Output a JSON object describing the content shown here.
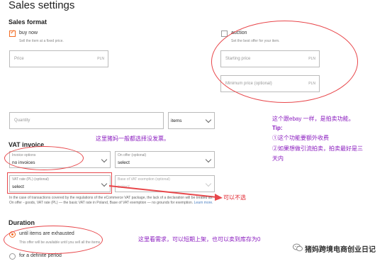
{
  "page": {
    "title": "Sales settings"
  },
  "sales_format": {
    "title": "Sales format",
    "buy_now": {
      "label": "buy now",
      "hint": "Sell the item at a fixed price.",
      "checked": true
    },
    "auction": {
      "label": "auction",
      "hint": "Set the best offer for your item.",
      "checked": false
    },
    "price": {
      "placeholder": "Price",
      "unit": "PLN"
    },
    "starting_price": {
      "placeholder": "Starting price",
      "unit": "PLN"
    },
    "minimum_price": {
      "placeholder": "Minimum price (optional)",
      "unit": "PLN"
    }
  },
  "quantity": {
    "placeholder": "Quantity",
    "unit_value": "items"
  },
  "vat_invoice": {
    "title": "VAT invoice",
    "invoice_options": {
      "label": "Invoice options",
      "value": "no invoices"
    },
    "on_offer": {
      "label": "On offer (optional)",
      "value": "select"
    },
    "vat_rate": {
      "label": "VAT rate (PL) (optional)",
      "value": "select"
    },
    "exemption": {
      "label": "Base of VAT exemption (optional)",
      "value": "select"
    },
    "note": "In the case of transactions covered by the regulations of the eCommerce VAT package, the lack of a declaration will be treated as: On offer - goods, VAT rate (PL) — the basic VAT rate in Poland, Base of VAT exemption — no grounds for exemption.",
    "learn_more": "Learn more."
  },
  "duration": {
    "title": "Duration",
    "until_exhausted": {
      "label": "until items are exhausted",
      "hint": "This offer will be available until you sell all the items.",
      "checked": true
    },
    "definite_period": {
      "label": "for a definite period",
      "checked": false
    }
  },
  "annotations": {
    "ebay_title": "这个跟ebay 一样，是拍卖功能。",
    "tip_label": "Tip:",
    "tip_1": "①这个功能要额外收费",
    "tip_2_line1": "②如果想做引流拍卖，拍卖最好是三",
    "tip_2_line2": "天内",
    "invoice_note": "这里猪妈一般都选择没发票。",
    "vat_note": "可以不选",
    "duration_note": "这里看需求，可以短期上架，也可以卖到库存为0"
  },
  "watermark": {
    "text": "猪妈跨境电商创业日记",
    "icon": "wechat-icon"
  },
  "colors": {
    "accent": "#f36b21",
    "annotation": "#8a1bbf",
    "markup": "#e8474b"
  }
}
